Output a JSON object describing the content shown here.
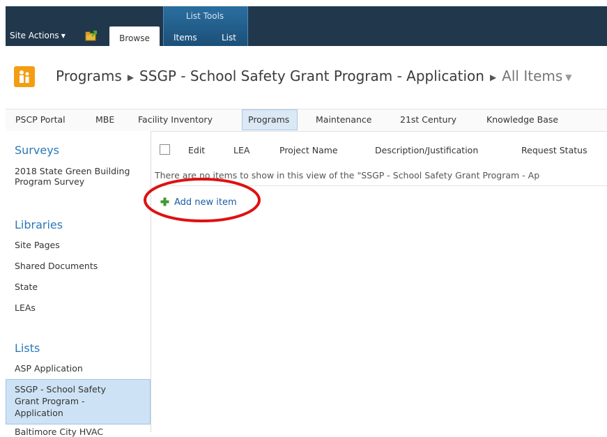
{
  "ribbon": {
    "site_actions": "Site Actions",
    "browse_tab": "Browse",
    "contextual_group": "List Tools",
    "items_tab": "Items",
    "list_tab": "List",
    "navigate_up_icon": "folder-up-icon"
  },
  "title": {
    "logo_icon": "people-icon",
    "breadcrumb": [
      "Programs",
      "SSGP - School Safety Grant Program - Application",
      "All Items"
    ]
  },
  "topnav": {
    "items": [
      "PSCP Portal",
      "MBE",
      "Facility Inventory",
      "Programs",
      "Maintenance",
      "21st Century",
      "Knowledge Base"
    ],
    "selected": "Programs"
  },
  "leftnav": {
    "surveys_heading": "Surveys",
    "surveys": [
      "2018 State Green Building Program Survey"
    ],
    "libraries_heading": "Libraries",
    "libraries": [
      "Site Pages",
      "Shared Documents",
      "State",
      "LEAs"
    ],
    "lists_heading": "Lists",
    "lists": [
      "ASP Application",
      "SSGP - School Safety Grant Program - Application",
      "Baltimore City HVAC"
    ]
  },
  "list": {
    "columns": [
      "Edit",
      "LEA",
      "Project Name",
      "Description/Justification",
      "Request Status"
    ],
    "empty_message": "There are no items to show in this view of the \"SSGP - School Safety Grant Program - Ap",
    "add_new_item": "Add new item"
  },
  "colors": {
    "ribbon_dark": "#21374c",
    "contextual_blue": "#1c4f78",
    "link_blue": "#2a78b8",
    "selected_bg": "#cde3f5",
    "annotation_red": "#e01010",
    "logo_orange": "#f49d12"
  }
}
